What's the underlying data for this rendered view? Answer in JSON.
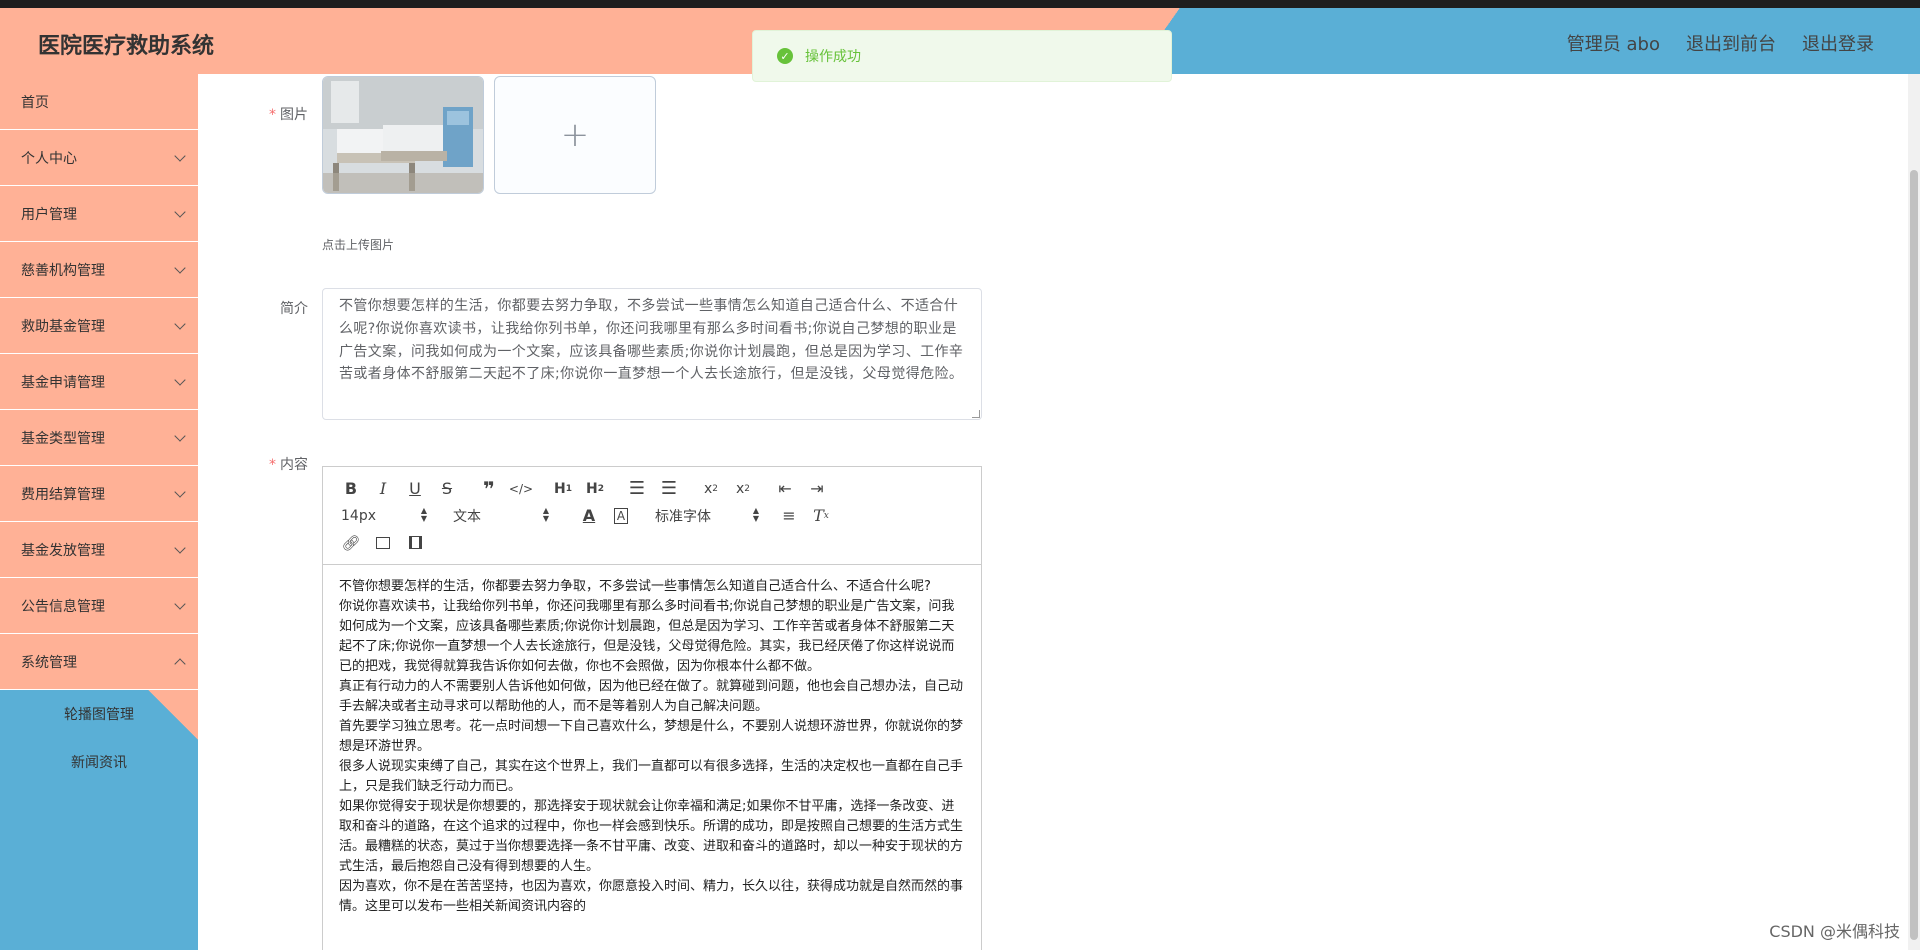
{
  "header": {
    "title": "医院医疗救助系统",
    "admin": "管理员 abo",
    "exit_front": "退出到前台",
    "logout": "退出登录"
  },
  "toast": {
    "message": "操作成功",
    "icon": "check-circle-icon"
  },
  "sidebar": {
    "items": [
      {
        "label": "首页",
        "has_arrow": false
      },
      {
        "label": "个人中心",
        "has_arrow": true
      },
      {
        "label": "用户管理",
        "has_arrow": true
      },
      {
        "label": "慈善机构管理",
        "has_arrow": true
      },
      {
        "label": "救助基金管理",
        "has_arrow": true
      },
      {
        "label": "基金申请管理",
        "has_arrow": true
      },
      {
        "label": "基金类型管理",
        "has_arrow": true
      },
      {
        "label": "费用结算管理",
        "has_arrow": true
      },
      {
        "label": "基金发放管理",
        "has_arrow": true
      },
      {
        "label": "公告信息管理",
        "has_arrow": true
      },
      {
        "label": "系统管理",
        "has_arrow": true
      }
    ],
    "subitems": [
      "轮播图管理",
      "新闻资讯"
    ]
  },
  "form": {
    "picture_label": "图片",
    "upload_tip": "点击上传图片",
    "upload_plus": "+",
    "intro_label": "简介",
    "intro_text": "不管你想要怎样的生活，你都要去努力争取，不多尝试一些事情怎么知道自己适合什么、不适合什么呢?你说你喜欢读书，让我给你列书单，你还问我哪里有那么多时间看书;你说自己梦想的职业是广告文案，问我如何成为一个文案，应该具备哪些素质;你说你计划晨跑，但总是因为学习、工作辛苦或者身体不舒服第二天起不了床;你说你一直梦想一个人去长途旅行，但是没钱，父母觉得危险。",
    "content_label": "内容"
  },
  "editor": {
    "font_size": "14px",
    "text_style": "文本",
    "font_family": "标准字体",
    "paragraphs": [
      "不管你想要怎样的生活，你都要去努力争取，不多尝试一些事情怎么知道自己适合什么、不适合什么呢?",
      "你说你喜欢读书，让我给你列书单，你还问我哪里有那么多时间看书;你说自己梦想的职业是广告文案，问我如何成为一个文案，应该具备哪些素质;你说你计划晨跑，但总是因为学习、工作辛苦或者身体不舒服第二天起不了床;你说你一直梦想一个人去长途旅行，但是没钱，父母觉得危险。其实，我已经厌倦了你这样说说而已的把戏，我觉得就算我告诉你如何去做，你也不会照做，因为你根本什么都不做。",
      "真正有行动力的人不需要别人告诉他如何做，因为他已经在做了。就算碰到问题，他也会自己想办法，自己动手去解决或者主动寻求可以帮助他的人，而不是等着别人为自己解决问题。",
      "首先要学习独立思考。花一点时间想一下自己喜欢什么，梦想是什么，不要别人说想环游世界，你就说你的梦想是环游世界。",
      "很多人说现实束缚了自己，其实在这个世界上，我们一直都可以有很多选择，生活的决定权也一直都在自己手上，只是我们缺乏行动力而已。",
      "如果你觉得安于现状是你想要的，那选择安于现状就会让你幸福和满足;如果你不甘平庸，选择一条改变、进取和奋斗的道路，在这个追求的过程中，你也一样会感到快乐。所谓的成功，即是按照自己想要的生活方式生活。最糟糕的状态，莫过于当你想要选择一条不甘平庸、改变、进取和奋斗的道路时，却以一种安于现状的方式生活，最后抱怨自己没有得到想要的人生。",
      "因为喜欢，你不是在苦苦坚持，也因为喜欢，你愿意投入时间、精力，长久以往，获得成功就是自然而然的事情。这里可以发布一些相关新闻资讯内容的"
    ]
  },
  "watermark": "CSDN @米偶科技"
}
